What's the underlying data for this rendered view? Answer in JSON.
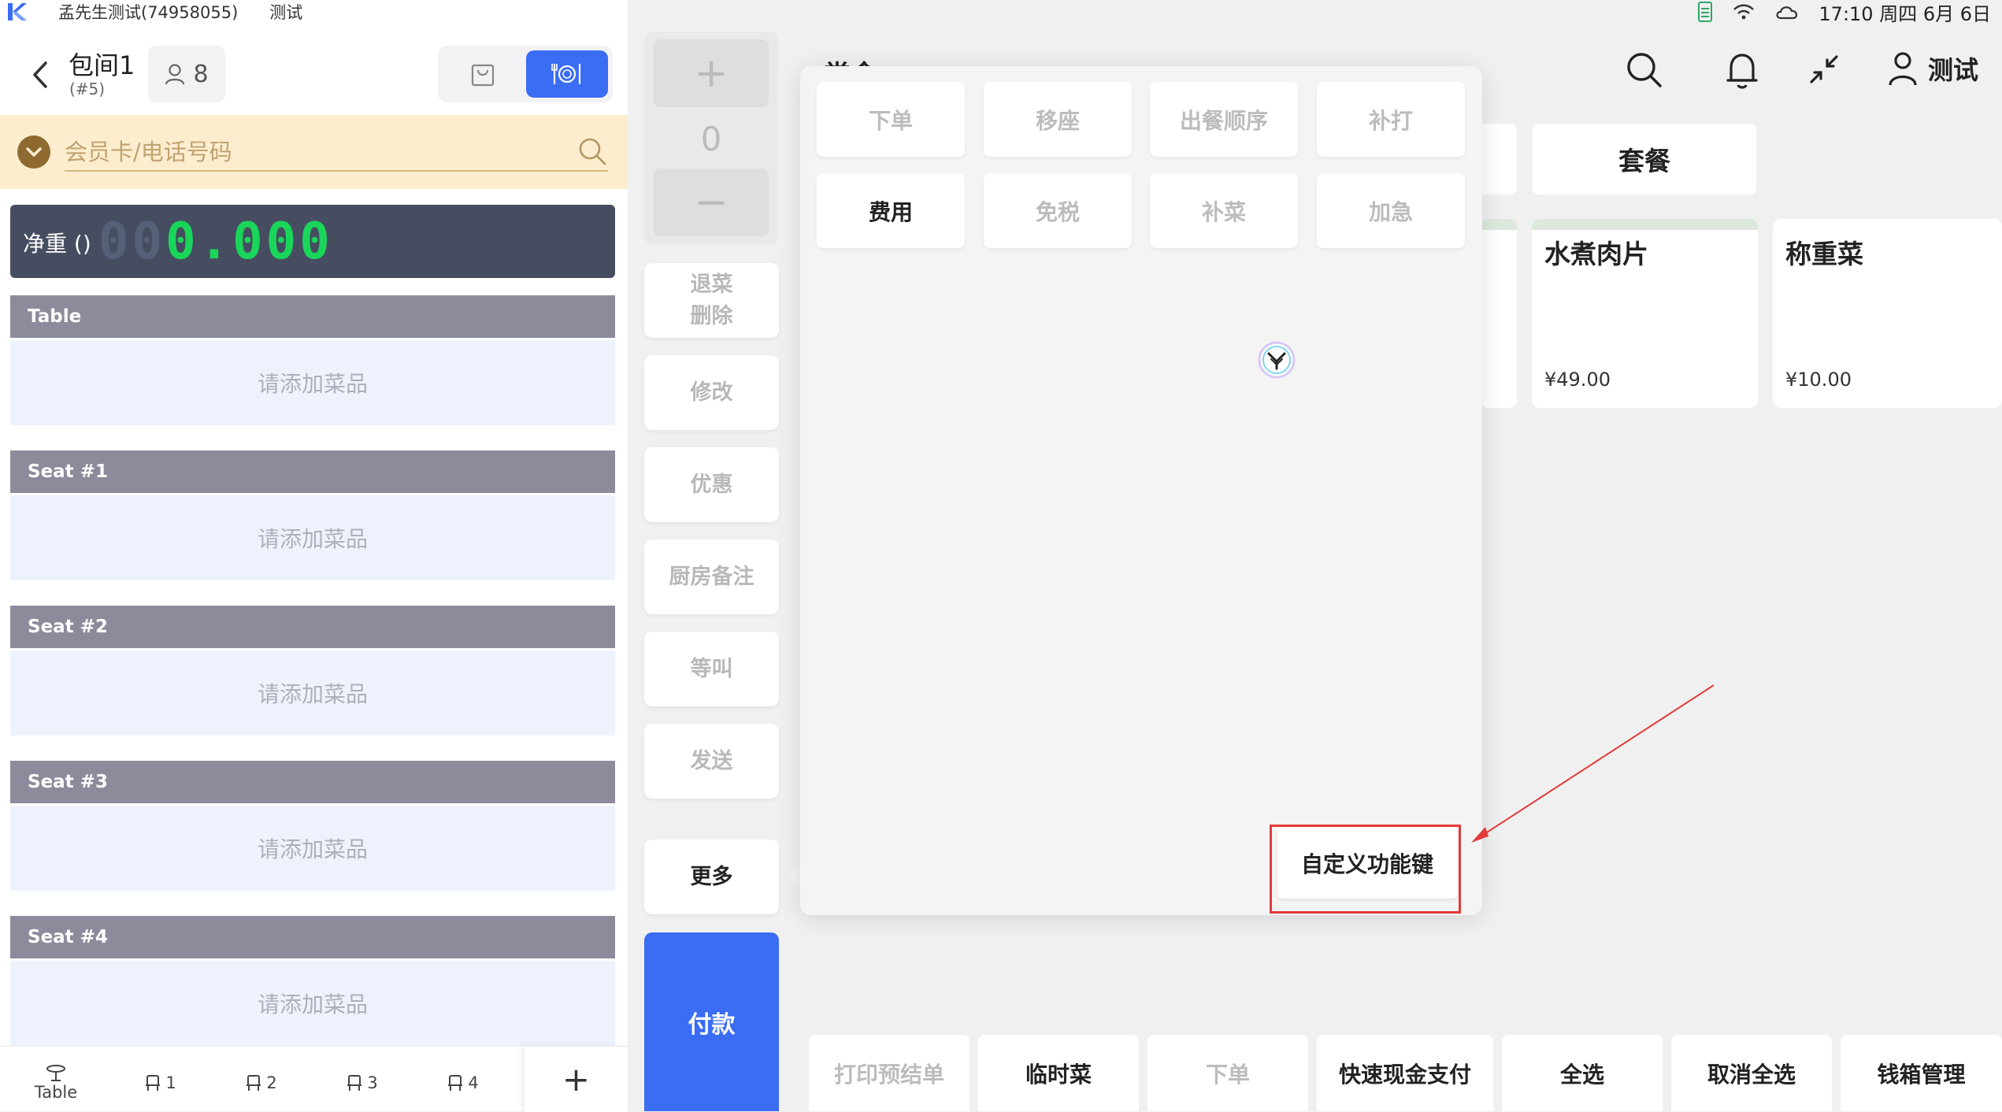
{
  "status_bar": {
    "account": "孟先生测试(74958055)",
    "store": "测试",
    "time": "17:10 周四 6月 6日"
  },
  "order": {
    "room_name": "包间1",
    "room_no": "(#5)",
    "guests": "8"
  },
  "member": {
    "placeholder": "会员卡/电话号码"
  },
  "scale": {
    "label": "净重 ()",
    "dim_digits": "00",
    "value": "0.000"
  },
  "sections": [
    {
      "header": "Table",
      "empty_text": "请添加菜品"
    },
    {
      "header": "Seat #1",
      "empty_text": "请添加菜品"
    },
    {
      "header": "Seat #2",
      "empty_text": "请添加菜品"
    },
    {
      "header": "Seat #3",
      "empty_text": "请添加菜品"
    },
    {
      "header": "Seat #4",
      "empty_text": "请添加菜品"
    }
  ],
  "seat_tabs": {
    "table": "Table",
    "seats": [
      "1",
      "2",
      "3",
      "4"
    ],
    "add": "+"
  },
  "qty": {
    "plus": "+",
    "value": "0",
    "minus": "−"
  },
  "side_actions": {
    "return_delete": [
      "退菜",
      "删除"
    ],
    "modify": "修改",
    "discount": "优惠",
    "kitchen_note": "厨房备注",
    "wait_call": "等叫",
    "send": "发送",
    "more": "更多",
    "pay": "付款"
  },
  "popup": {
    "row1": [
      "下单",
      "移座",
      "出餐顺序",
      "补打"
    ],
    "row2": [
      "费用",
      "免税",
      "补菜",
      "加急"
    ],
    "custom_key": "自定义功能键"
  },
  "header": {
    "partial_title": "堂食",
    "user": "测试"
  },
  "categories": {
    "combo": "套餐"
  },
  "dishes": [
    {
      "name": "水煮肉片",
      "price": "¥49.00"
    },
    {
      "name": "称重菜",
      "price": "¥10.00"
    }
  ],
  "bottom_actions": [
    "打印预结单",
    "临时菜",
    "下单",
    "快速现金支付",
    "全选",
    "取消全选",
    "钱箱管理"
  ],
  "colors": {
    "accent": "#3a6cf4",
    "scale_bg": "#464d60",
    "scale_digits": "#19d65a",
    "section_header": "#8d8b9b",
    "member_bg": "#fcedcf",
    "annotation_red": "#e23a3a"
  }
}
